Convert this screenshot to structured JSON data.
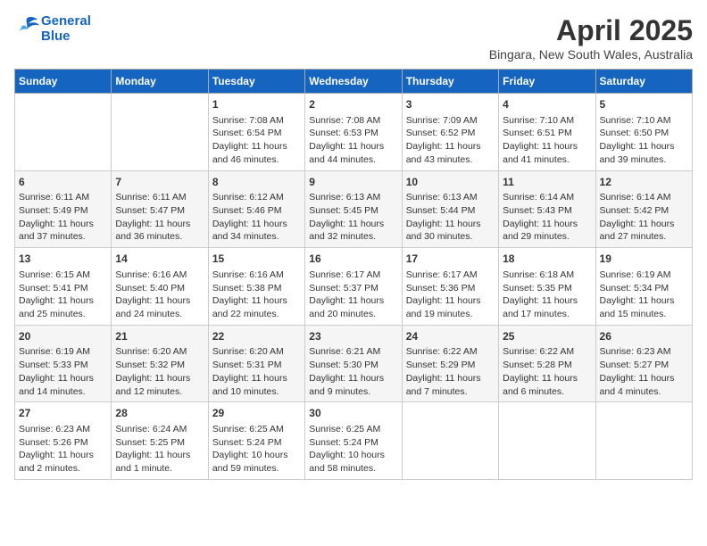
{
  "header": {
    "logo_line1": "General",
    "logo_line2": "Blue",
    "month": "April 2025",
    "location": "Bingara, New South Wales, Australia"
  },
  "weekdays": [
    "Sunday",
    "Monday",
    "Tuesday",
    "Wednesday",
    "Thursday",
    "Friday",
    "Saturday"
  ],
  "weeks": [
    [
      null,
      null,
      {
        "day": 1,
        "sunrise": "Sunrise: 7:08 AM",
        "sunset": "Sunset: 6:54 PM",
        "daylight": "Daylight: 11 hours and 46 minutes."
      },
      {
        "day": 2,
        "sunrise": "Sunrise: 7:08 AM",
        "sunset": "Sunset: 6:53 PM",
        "daylight": "Daylight: 11 hours and 44 minutes."
      },
      {
        "day": 3,
        "sunrise": "Sunrise: 7:09 AM",
        "sunset": "Sunset: 6:52 PM",
        "daylight": "Daylight: 11 hours and 43 minutes."
      },
      {
        "day": 4,
        "sunrise": "Sunrise: 7:10 AM",
        "sunset": "Sunset: 6:51 PM",
        "daylight": "Daylight: 11 hours and 41 minutes."
      },
      {
        "day": 5,
        "sunrise": "Sunrise: 7:10 AM",
        "sunset": "Sunset: 6:50 PM",
        "daylight": "Daylight: 11 hours and 39 minutes."
      }
    ],
    [
      {
        "day": 6,
        "sunrise": "Sunrise: 6:11 AM",
        "sunset": "Sunset: 5:49 PM",
        "daylight": "Daylight: 11 hours and 37 minutes."
      },
      {
        "day": 7,
        "sunrise": "Sunrise: 6:11 AM",
        "sunset": "Sunset: 5:47 PM",
        "daylight": "Daylight: 11 hours and 36 minutes."
      },
      {
        "day": 8,
        "sunrise": "Sunrise: 6:12 AM",
        "sunset": "Sunset: 5:46 PM",
        "daylight": "Daylight: 11 hours and 34 minutes."
      },
      {
        "day": 9,
        "sunrise": "Sunrise: 6:13 AM",
        "sunset": "Sunset: 5:45 PM",
        "daylight": "Daylight: 11 hours and 32 minutes."
      },
      {
        "day": 10,
        "sunrise": "Sunrise: 6:13 AM",
        "sunset": "Sunset: 5:44 PM",
        "daylight": "Daylight: 11 hours and 30 minutes."
      },
      {
        "day": 11,
        "sunrise": "Sunrise: 6:14 AM",
        "sunset": "Sunset: 5:43 PM",
        "daylight": "Daylight: 11 hours and 29 minutes."
      },
      {
        "day": 12,
        "sunrise": "Sunrise: 6:14 AM",
        "sunset": "Sunset: 5:42 PM",
        "daylight": "Daylight: 11 hours and 27 minutes."
      }
    ],
    [
      {
        "day": 13,
        "sunrise": "Sunrise: 6:15 AM",
        "sunset": "Sunset: 5:41 PM",
        "daylight": "Daylight: 11 hours and 25 minutes."
      },
      {
        "day": 14,
        "sunrise": "Sunrise: 6:16 AM",
        "sunset": "Sunset: 5:40 PM",
        "daylight": "Daylight: 11 hours and 24 minutes."
      },
      {
        "day": 15,
        "sunrise": "Sunrise: 6:16 AM",
        "sunset": "Sunset: 5:38 PM",
        "daylight": "Daylight: 11 hours and 22 minutes."
      },
      {
        "day": 16,
        "sunrise": "Sunrise: 6:17 AM",
        "sunset": "Sunset: 5:37 PM",
        "daylight": "Daylight: 11 hours and 20 minutes."
      },
      {
        "day": 17,
        "sunrise": "Sunrise: 6:17 AM",
        "sunset": "Sunset: 5:36 PM",
        "daylight": "Daylight: 11 hours and 19 minutes."
      },
      {
        "day": 18,
        "sunrise": "Sunrise: 6:18 AM",
        "sunset": "Sunset: 5:35 PM",
        "daylight": "Daylight: 11 hours and 17 minutes."
      },
      {
        "day": 19,
        "sunrise": "Sunrise: 6:19 AM",
        "sunset": "Sunset: 5:34 PM",
        "daylight": "Daylight: 11 hours and 15 minutes."
      }
    ],
    [
      {
        "day": 20,
        "sunrise": "Sunrise: 6:19 AM",
        "sunset": "Sunset: 5:33 PM",
        "daylight": "Daylight: 11 hours and 14 minutes."
      },
      {
        "day": 21,
        "sunrise": "Sunrise: 6:20 AM",
        "sunset": "Sunset: 5:32 PM",
        "daylight": "Daylight: 11 hours and 12 minutes."
      },
      {
        "day": 22,
        "sunrise": "Sunrise: 6:20 AM",
        "sunset": "Sunset: 5:31 PM",
        "daylight": "Daylight: 11 hours and 10 minutes."
      },
      {
        "day": 23,
        "sunrise": "Sunrise: 6:21 AM",
        "sunset": "Sunset: 5:30 PM",
        "daylight": "Daylight: 11 hours and 9 minutes."
      },
      {
        "day": 24,
        "sunrise": "Sunrise: 6:22 AM",
        "sunset": "Sunset: 5:29 PM",
        "daylight": "Daylight: 11 hours and 7 minutes."
      },
      {
        "day": 25,
        "sunrise": "Sunrise: 6:22 AM",
        "sunset": "Sunset: 5:28 PM",
        "daylight": "Daylight: 11 hours and 6 minutes."
      },
      {
        "day": 26,
        "sunrise": "Sunrise: 6:23 AM",
        "sunset": "Sunset: 5:27 PM",
        "daylight": "Daylight: 11 hours and 4 minutes."
      }
    ],
    [
      {
        "day": 27,
        "sunrise": "Sunrise: 6:23 AM",
        "sunset": "Sunset: 5:26 PM",
        "daylight": "Daylight: 11 hours and 2 minutes."
      },
      {
        "day": 28,
        "sunrise": "Sunrise: 6:24 AM",
        "sunset": "Sunset: 5:25 PM",
        "daylight": "Daylight: 11 hours and 1 minute."
      },
      {
        "day": 29,
        "sunrise": "Sunrise: 6:25 AM",
        "sunset": "Sunset: 5:24 PM",
        "daylight": "Daylight: 10 hours and 59 minutes."
      },
      {
        "day": 30,
        "sunrise": "Sunrise: 6:25 AM",
        "sunset": "Sunset: 5:24 PM",
        "daylight": "Daylight: 10 hours and 58 minutes."
      },
      null,
      null,
      null
    ]
  ]
}
